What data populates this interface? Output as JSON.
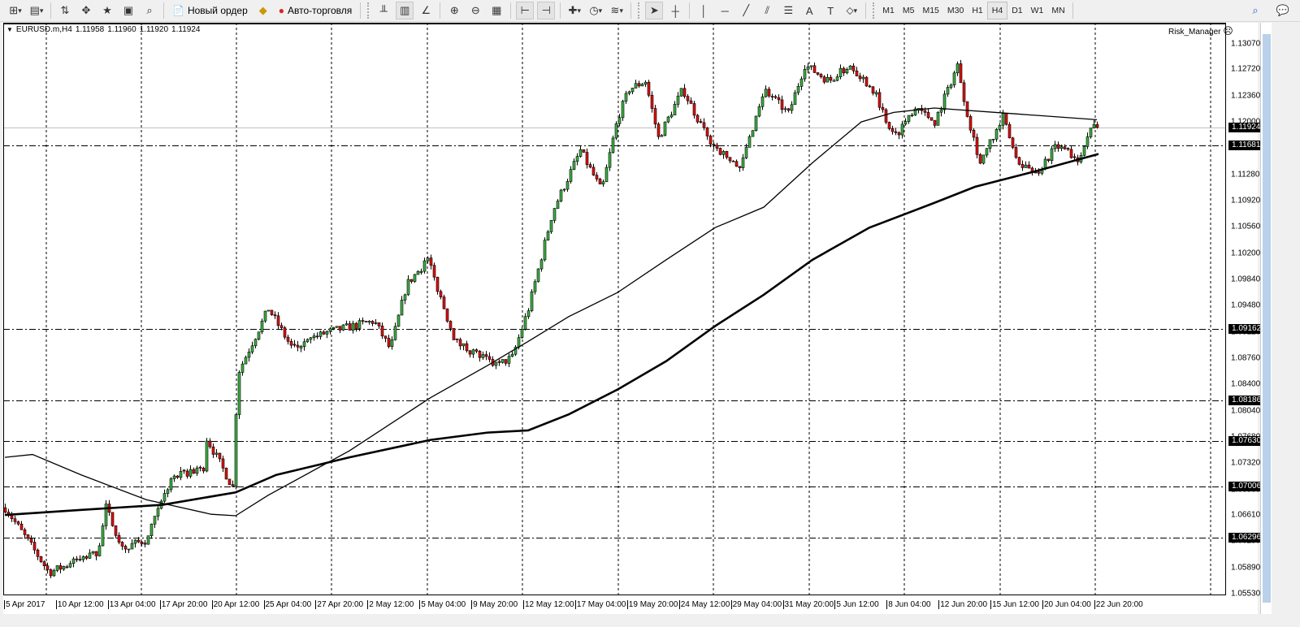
{
  "toolbar": {
    "icons_left": [
      {
        "name": "new-chart-icon",
        "glyph": "⊞",
        "dropdown": true
      },
      {
        "name": "profiles-icon",
        "glyph": "▤",
        "dropdown": true
      },
      {
        "name": "market-watch-icon",
        "glyph": "⇅"
      },
      {
        "name": "navigator-crosshair-icon",
        "glyph": "✥"
      },
      {
        "name": "favorites-folder-icon",
        "glyph": "★"
      },
      {
        "name": "terminal-icon",
        "glyph": "▣"
      },
      {
        "name": "strategy-tester-icon",
        "glyph": "⌕"
      }
    ],
    "new_order_label": "Новый ордер",
    "auto_trading_label": "Авто-торговля",
    "icons_mid": [
      {
        "name": "bar-chart-icon",
        "glyph": "╨"
      },
      {
        "name": "candlestick-icon",
        "glyph": "▥",
        "active": true
      },
      {
        "name": "line-chart-icon",
        "glyph": "∠"
      },
      {
        "name": "zoom-in-icon",
        "glyph": "⊕"
      },
      {
        "name": "zoom-out-icon",
        "glyph": "⊖"
      },
      {
        "name": "tile-windows-icon",
        "glyph": "▦"
      },
      {
        "name": "chart-shift-icon",
        "glyph": "⊢",
        "active": true
      },
      {
        "name": "autoscroll-icon",
        "glyph": "⊣",
        "active": true
      },
      {
        "name": "indicators-icon",
        "glyph": "✚",
        "dropdown": true
      },
      {
        "name": "periods-clock-icon",
        "glyph": "◷",
        "dropdown": true
      },
      {
        "name": "templates-icon",
        "glyph": "≋",
        "dropdown": true
      }
    ],
    "icons_draw": [
      {
        "name": "cursor-arrow-icon",
        "glyph": "➤",
        "active": true
      },
      {
        "name": "crosshair-icon",
        "glyph": "┼"
      },
      {
        "name": "vertical-line-icon",
        "glyph": "│"
      },
      {
        "name": "horizontal-line-icon",
        "glyph": "─"
      },
      {
        "name": "trendline-icon",
        "glyph": "╱"
      },
      {
        "name": "equidistant-channel-icon",
        "glyph": "⫽"
      },
      {
        "name": "fibonacci-icon",
        "glyph": "☰"
      },
      {
        "name": "text-icon",
        "glyph": "A"
      },
      {
        "name": "text-label-icon",
        "glyph": "T"
      },
      {
        "name": "arrows-icon",
        "glyph": "⬦",
        "dropdown": true
      }
    ],
    "timeframes": [
      "M1",
      "M5",
      "M15",
      "M30",
      "H1",
      "H4",
      "D1",
      "W1",
      "MN"
    ],
    "active_timeframe": "H4",
    "search_icon": "⌕",
    "chat_icon": "💬"
  },
  "chart": {
    "symbol": "EURUSD.m,H4",
    "open": "1.11958",
    "high": "1.11960",
    "low": "1.11920",
    "close": "1.11924",
    "expert": "Risk_Manager",
    "expert_icon": "☹",
    "colors": {
      "bull": "#3cb043",
      "bear": "#e01010",
      "wick": "#000000",
      "bid_line": "#c0c0c0"
    },
    "price_scale": [
      "1.13070",
      "1.12720",
      "1.12360",
      "1.12000",
      "1.11640",
      "1.11280",
      "1.10920",
      "1.10560",
      "1.10200",
      "1.09840",
      "1.09480",
      "1.09120",
      "1.08760",
      "1.08400",
      "1.08040",
      "1.07680",
      "1.07320",
      "1.06960",
      "1.06610",
      "1.06250",
      "1.05890",
      "1.05530"
    ],
    "price_range": [
      1.0553,
      1.1307
    ],
    "bid": "1.11924",
    "levels": [
      "1.11681",
      "1.09162",
      "1.08186",
      "1.07630",
      "1.07006",
      "1.06296"
    ],
    "time_labels": [
      "5 Apr 2017",
      "10 Apr 12:00",
      "13 Apr 04:00",
      "17 Apr 20:00",
      "20 Apr 12:00",
      "25 Apr 04:00",
      "27 Apr 20:00",
      "2 May 12:00",
      "5 May 04:00",
      "9 May 20:00",
      "12 May 12:00",
      "17 May 04:00",
      "19 May 20:00",
      "24 May 12:00",
      "29 May 04:00",
      "31 May 20:00",
      "5 Jun 12:00",
      "8 Jun 04:00",
      "12 Jun 20:00",
      "15 Jun 12:00",
      "20 Jun 04:00",
      "22 Jun 20:00"
    ],
    "bar_count": 337,
    "price_path": [
      [
        0,
        1.0671
      ],
      [
        11,
        1.0599
      ],
      [
        13.5,
        1.0582
      ],
      [
        28.5,
        1.061
      ],
      [
        31,
        1.0671
      ],
      [
        36,
        1.0616
      ],
      [
        43.5,
        1.0627
      ],
      [
        51,
        1.071
      ],
      [
        61,
        1.0727
      ],
      [
        62,
        1.0766
      ],
      [
        70,
        1.0699
      ],
      [
        71.5,
        1.0855
      ],
      [
        81,
        1.0944
      ],
      [
        88.5,
        1.0888
      ],
      [
        98.5,
        1.0911
      ],
      [
        113.5,
        1.0927
      ],
      [
        118.5,
        1.0888
      ],
      [
        123.5,
        1.0977
      ],
      [
        130,
        1.1011
      ],
      [
        138.5,
        1.0899
      ],
      [
        151,
        1.0866
      ],
      [
        156,
        1.0877
      ],
      [
        161,
        1.0944
      ],
      [
        168.5,
        1.1078
      ],
      [
        177,
        1.1161
      ],
      [
        183.5,
        1.1105
      ],
      [
        188.5,
        1.1206
      ],
      [
        192,
        1.1245
      ],
      [
        197,
        1.1256
      ],
      [
        201,
        1.1178
      ],
      [
        208.5,
        1.1245
      ],
      [
        216,
        1.1178
      ],
      [
        226,
        1.1133
      ],
      [
        233.5,
        1.1245
      ],
      [
        241,
        1.1211
      ],
      [
        246,
        1.1278
      ],
      [
        253.5,
        1.1256
      ],
      [
        260,
        1.1278
      ],
      [
        267,
        1.1245
      ],
      [
        273.5,
        1.1178
      ],
      [
        280,
        1.1222
      ],
      [
        286,
        1.12
      ],
      [
        293,
        1.1278
      ],
      [
        296,
        1.1211
      ],
      [
        300,
        1.1144
      ],
      [
        307,
        1.1206
      ],
      [
        311,
        1.115
      ],
      [
        317,
        1.1128
      ],
      [
        323.5,
        1.1167
      ],
      [
        330,
        1.115
      ],
      [
        335,
        1.12
      ],
      [
        336,
        1.11924
      ]
    ],
    "ma_fast": [
      [
        0,
        1.074
      ],
      [
        8.5,
        1.0744
      ],
      [
        23.5,
        1.0716
      ],
      [
        43.5,
        1.0682
      ],
      [
        63.5,
        1.0662
      ],
      [
        71,
        1.066
      ],
      [
        81,
        1.0688
      ],
      [
        106,
        1.0749
      ],
      [
        131,
        1.0822
      ],
      [
        148.5,
        1.0866
      ],
      [
        161,
        1.0899
      ],
      [
        173.5,
        1.0933
      ],
      [
        188.5,
        1.0966
      ],
      [
        203.5,
        1.1011
      ],
      [
        218.5,
        1.1055
      ],
      [
        233.5,
        1.1083
      ],
      [
        248.5,
        1.1144
      ],
      [
        263.5,
        1.12
      ],
      [
        273.5,
        1.1213
      ],
      [
        286,
        1.1219
      ],
      [
        311,
        1.1211
      ],
      [
        336,
        1.1203
      ]
    ],
    "ma_slow": [
      [
        0,
        1.0661
      ],
      [
        23.5,
        1.0668
      ],
      [
        48.5,
        1.0675
      ],
      [
        71,
        1.0692
      ],
      [
        83.5,
        1.0716
      ],
      [
        106,
        1.074
      ],
      [
        131,
        1.0764
      ],
      [
        148.5,
        1.0774
      ],
      [
        161,
        1.0777
      ],
      [
        173.5,
        1.0799
      ],
      [
        188.5,
        1.0833
      ],
      [
        203.5,
        1.0872
      ],
      [
        218.5,
        1.092
      ],
      [
        233.5,
        1.0963
      ],
      [
        248.5,
        1.1011
      ],
      [
        266,
        1.1055
      ],
      [
        286,
        1.1089
      ],
      [
        298.5,
        1.1111
      ],
      [
        316,
        1.1131
      ],
      [
        336.5,
        1.1156
      ]
    ]
  }
}
